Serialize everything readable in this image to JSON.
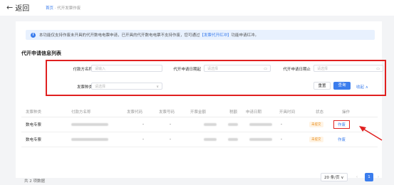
{
  "header": {
    "back_label": "返回",
    "breadcrumb_home": "首页",
    "breadcrumb_sep": "·",
    "breadcrumb_current": "代开发票作废"
  },
  "notice": {
    "text_before": "本功能仅支持作废未开具的代开数电电票申请，已开具的代开数电电票不支持作废，您可通过",
    "link": "【发票代开红冲】",
    "text_after": "功能申请红冲。"
  },
  "list_title": "代开申请信息列表",
  "filters": {
    "payer_label": "付款方名称",
    "payer_placeholder": "请输入",
    "start_label": "代开申请日期起",
    "start_placeholder": "请选择",
    "end_label": "代开申请日期止",
    "end_placeholder": "请选择",
    "type_label": "发票种类",
    "type_placeholder": "请选择",
    "reset": "重置",
    "search": "查询",
    "collapse": "收起 ∧"
  },
  "table": {
    "headers": [
      "发票种类",
      "付款方名称",
      "发票代码",
      "发票号码",
      "开票金额",
      "税额",
      "申请日期",
      "开具时间",
      "状态",
      "操作"
    ],
    "rows": [
      {
        "type": "数电专票",
        "code": "-",
        "number": "-",
        "issue_time": "-",
        "status": "未提交",
        "action": "作废"
      },
      {
        "type": "数电专票",
        "code": "-",
        "number": "-",
        "issue_time": "-",
        "status": "未提交",
        "action": "作废"
      }
    ]
  },
  "footer": {
    "total": "共 2 项数据",
    "page_size": "20 条/页 ∨",
    "prev": "‹",
    "current_page": "1",
    "next": "›"
  },
  "colors": {
    "accent": "#3b7ded",
    "highlight": "#e02020",
    "status_warning": "#e88c1a"
  }
}
